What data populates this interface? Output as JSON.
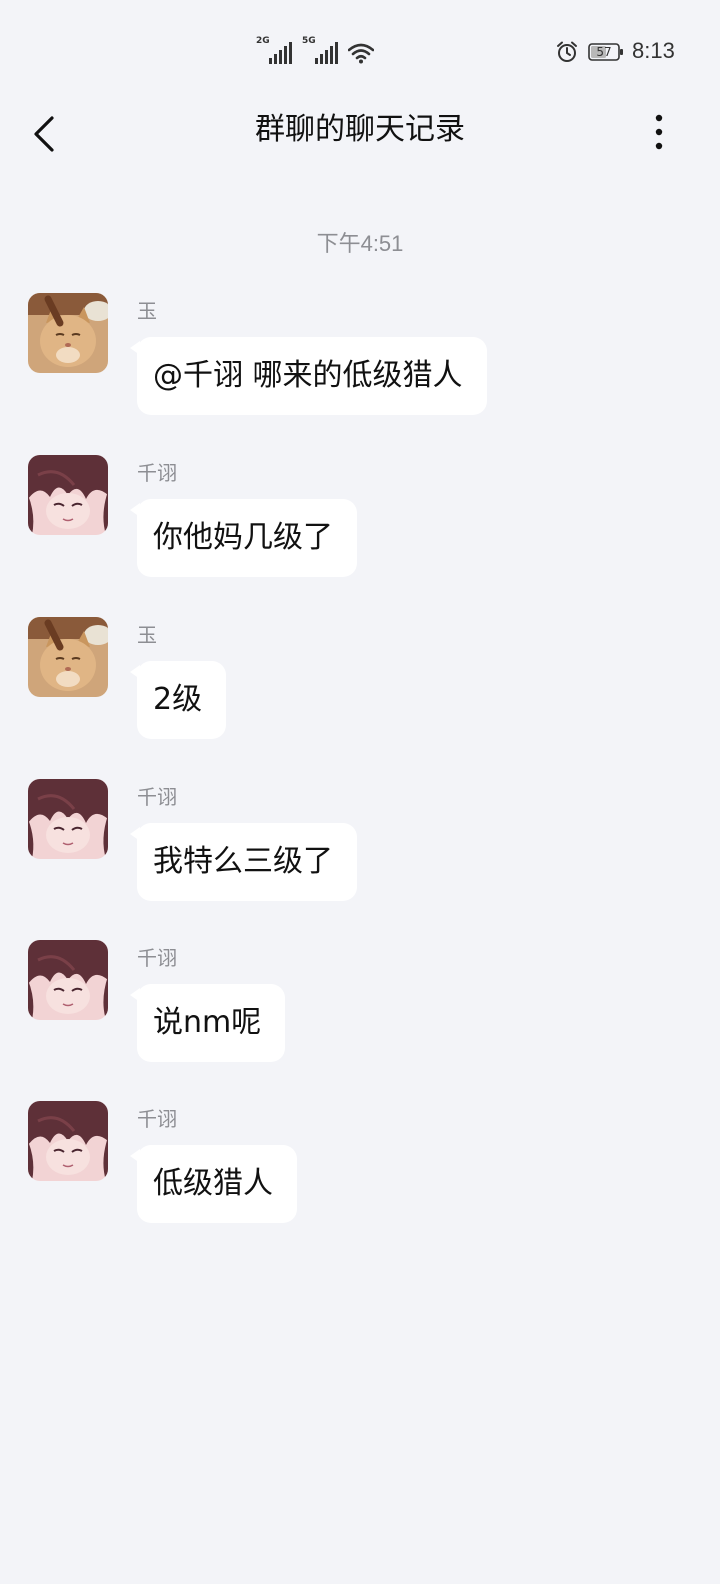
{
  "status_bar": {
    "signal_1_network": "2G",
    "signal_2_network": "5G",
    "battery_level": "57",
    "time": "8:13"
  },
  "header": {
    "title": "群聊的聊天记录",
    "back_icon": "chevron-left-icon",
    "more_icon": "more-vertical-icon"
  },
  "chat": {
    "timestamp": "下午4:51",
    "messages": [
      {
        "sender": "玉",
        "avatar": "cat-avatar",
        "text": "@千诩 哪来的低级猎人"
      },
      {
        "sender": "千诩",
        "avatar": "anime-avatar",
        "text": "你他妈几级了"
      },
      {
        "sender": "玉",
        "avatar": "cat-avatar",
        "text": "2级"
      },
      {
        "sender": "千诩",
        "avatar": "anime-avatar",
        "text": "我特么三级了"
      },
      {
        "sender": "千诩",
        "avatar": "anime-avatar",
        "text": "说nm呢"
      },
      {
        "sender": "千诩",
        "avatar": "anime-avatar",
        "text": "低级猎人"
      }
    ]
  },
  "colors": {
    "background": "#f3f4f8",
    "bubble": "#ffffff",
    "secondary_text": "#8d8e93",
    "primary_text": "#111111"
  }
}
